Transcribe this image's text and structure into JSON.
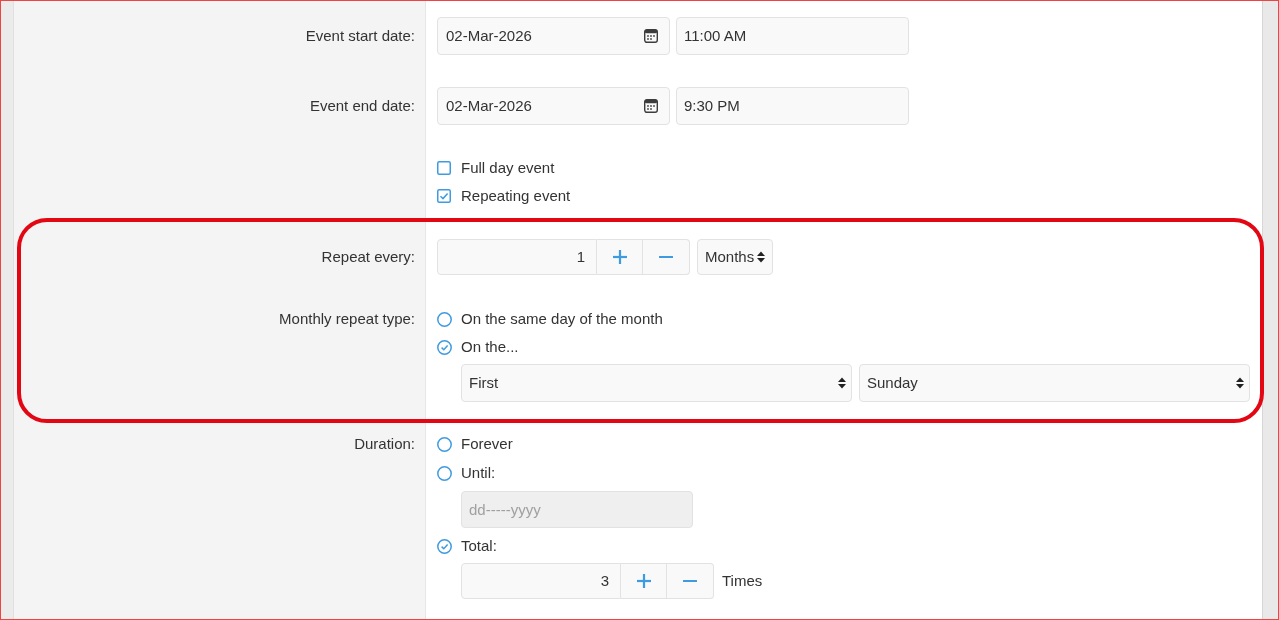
{
  "form": {
    "sections": [
      {
        "kind": "datetime",
        "highlighted": false,
        "label": "Event start date:",
        "date": "02-Mar-2026",
        "time": "11:00 AM"
      },
      {
        "kind": "datetime",
        "highlighted": false,
        "label": "Event end date:",
        "date": "02-Mar-2026",
        "time": "9:30 PM"
      },
      {
        "kind": "checkboxes",
        "highlighted": false,
        "options": [
          {
            "label": "Full day event",
            "checked": false
          },
          {
            "label": "Repeating event",
            "checked": true
          }
        ]
      },
      {
        "kind": "interval",
        "highlighted": true,
        "label": "Repeat every:",
        "value": "1",
        "unit": "Months"
      },
      {
        "kind": "monthly",
        "highlighted": true,
        "label": "Monthly repeat type:",
        "options": [
          {
            "label": "On the same day of the month",
            "selected": false
          },
          {
            "label": "On the...",
            "selected": true
          }
        ],
        "ordinal": "First",
        "weekday": "Sunday"
      },
      {
        "kind": "duration",
        "highlighted": false,
        "label": "Duration:",
        "options": [
          {
            "kind": "plain",
            "label": "Forever",
            "selected": false
          },
          {
            "kind": "date",
            "label": "Until:",
            "selected": false,
            "placeholder": "dd-----yyyy",
            "disabled": true
          },
          {
            "kind": "count",
            "label": "Total:",
            "selected": true,
            "value": "3",
            "suffix": "Times"
          }
        ]
      }
    ]
  }
}
